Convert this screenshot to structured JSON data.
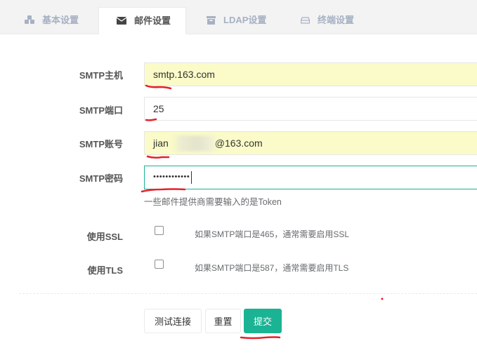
{
  "tabs": [
    {
      "label": "基本设置",
      "icon": "cubes-icon"
    },
    {
      "label": "邮件设置",
      "icon": "envelope-icon"
    },
    {
      "label": "LDAP设置",
      "icon": "archive-icon"
    },
    {
      "label": "终端设置",
      "icon": "hdd-icon"
    }
  ],
  "form": {
    "smtp_host": {
      "label": "SMTP主机",
      "value": "smtp.163.com"
    },
    "smtp_port": {
      "label": "SMTP端口",
      "value": "25"
    },
    "smtp_user": {
      "label": "SMTP账号",
      "value_prefix": "jian",
      "value_suffix": "@163.com"
    },
    "smtp_password": {
      "label": "SMTP密码",
      "value": "••••••••••••",
      "help": "一些邮件提供商需要输入的是Token"
    },
    "use_ssl": {
      "label": "使用SSL",
      "checked": false,
      "help": "如果SMTP端口是465，通常需要启用SSL"
    },
    "use_tls": {
      "label": "使用TLS",
      "checked": false,
      "help": "如果SMTP端口是587，通常需要启用TLS"
    }
  },
  "buttons": {
    "test": "测试连接",
    "reset": "重置",
    "submit": "提交"
  },
  "colors": {
    "primary": "#1ab394",
    "autofill": "#fafbc8",
    "annotation": "#e8202a"
  }
}
